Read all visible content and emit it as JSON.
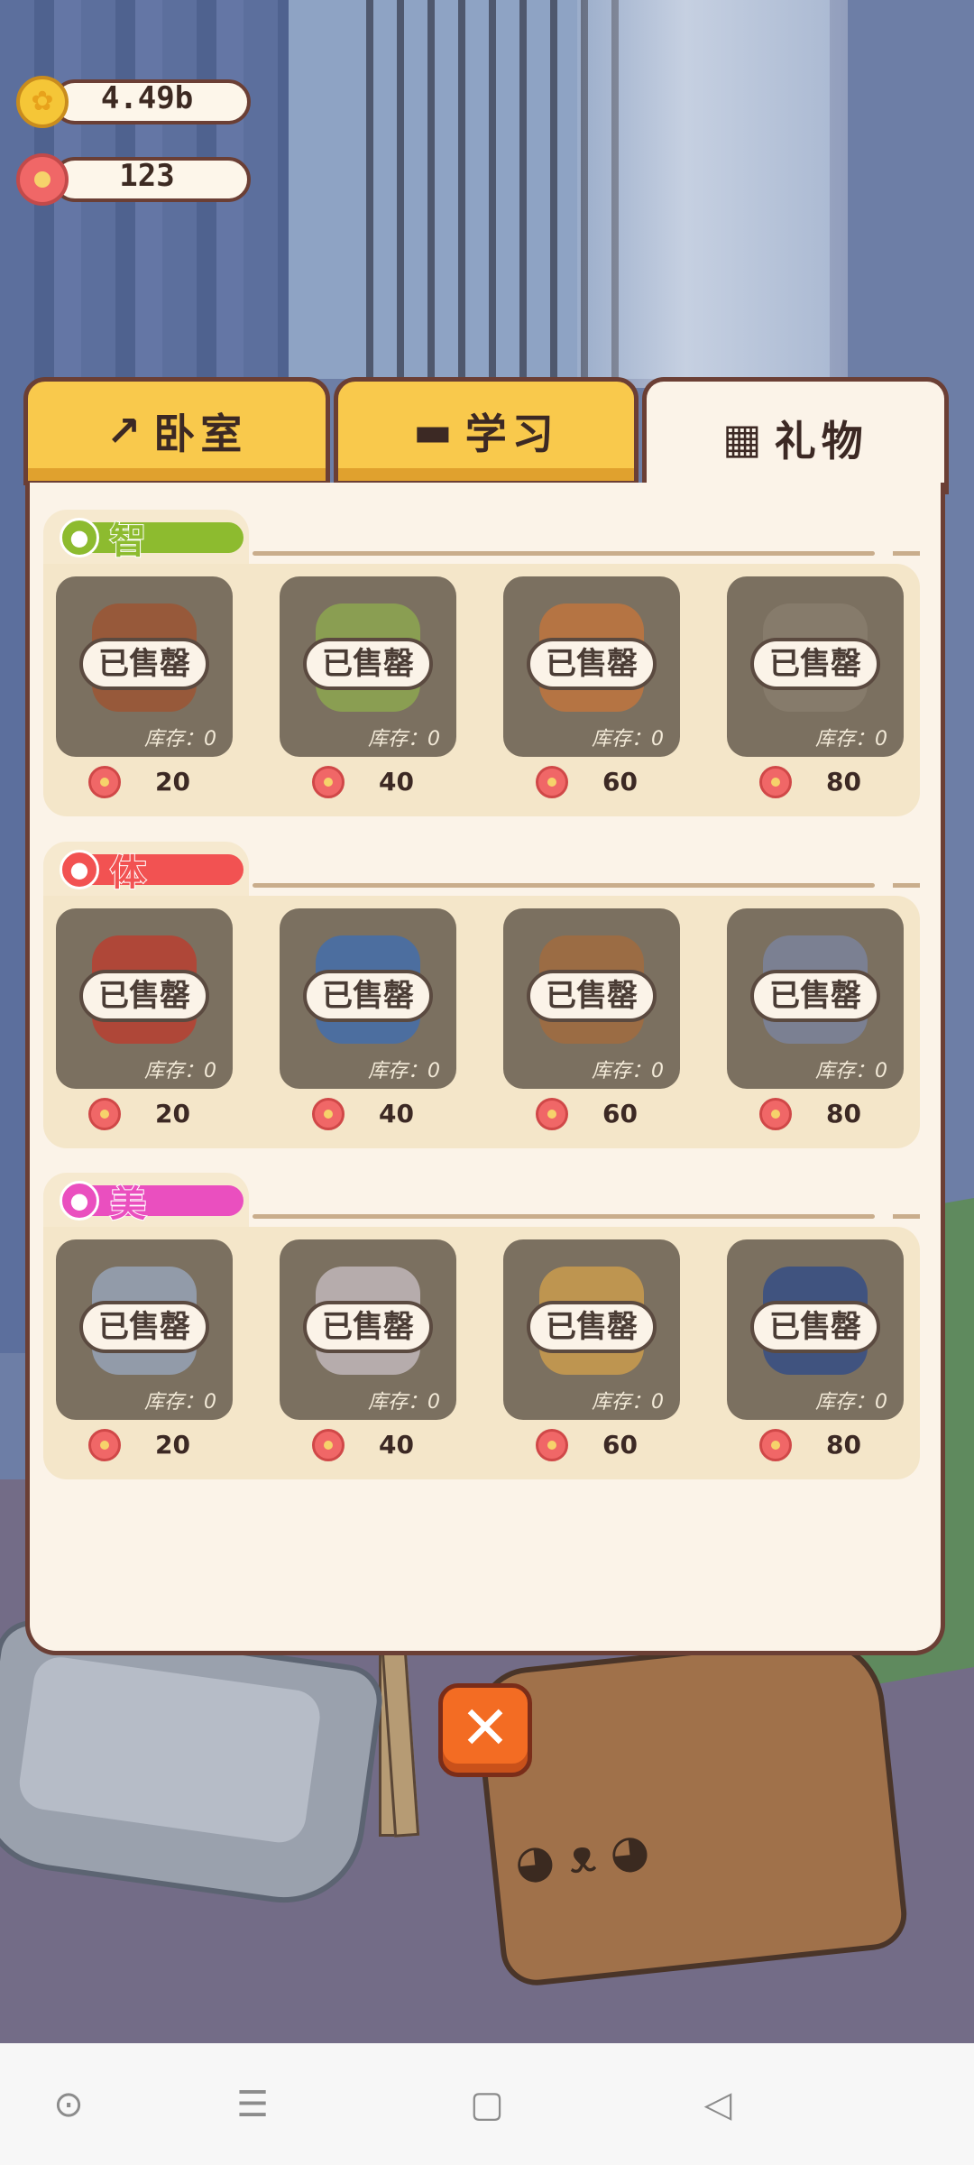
{
  "currency": {
    "coins": "4.49b",
    "flowers": "123"
  },
  "tabs": [
    {
      "label": "卧室",
      "icon": "hammer-icon",
      "active": false
    },
    {
      "label": "学习",
      "icon": "graduation-cap-icon",
      "active": false
    },
    {
      "label": "礼物",
      "icon": "gift-icon",
      "active": true
    }
  ],
  "sections": [
    {
      "title": "智",
      "icon": "lightbulb-icon",
      "color": "#8dbb2f",
      "title_color": "#8dbb2f",
      "items": [
        {
          "status": "已售罄",
          "stock": "库存：0",
          "price": "20"
        },
        {
          "status": "已售罄",
          "stock": "库存：0",
          "price": "40"
        },
        {
          "status": "已售罄",
          "stock": "库存：0",
          "price": "60"
        },
        {
          "status": "已售罄",
          "stock": "库存：0",
          "price": "80"
        }
      ]
    },
    {
      "title": "体",
      "icon": "basketball-icon",
      "color": "#f25252",
      "title_color": "#f25252",
      "items": [
        {
          "status": "已售罄",
          "stock": "库存：0",
          "price": "20"
        },
        {
          "status": "已售罄",
          "stock": "库存：0",
          "price": "40"
        },
        {
          "status": "已售罄",
          "stock": "库存：0",
          "price": "60"
        },
        {
          "status": "已售罄",
          "stock": "库存：0",
          "price": "80"
        }
      ]
    },
    {
      "title": "美",
      "icon": "music-note-icon",
      "color": "#ea4fbf",
      "title_color": "#ea4fbf",
      "items": [
        {
          "status": "已售罄",
          "stock": "库存：0",
          "price": "20"
        },
        {
          "status": "已售罄",
          "stock": "库存：0",
          "price": "40"
        },
        {
          "status": "已售罄",
          "stock": "库存：0",
          "price": "60"
        },
        {
          "status": "已售罄",
          "stock": "库存：0",
          "price": "80"
        }
      ]
    }
  ],
  "close_icon": "close-icon",
  "navbar": [
    "home-circle-icon",
    "menu-icon",
    "square-icon",
    "back-triangle-icon"
  ]
}
